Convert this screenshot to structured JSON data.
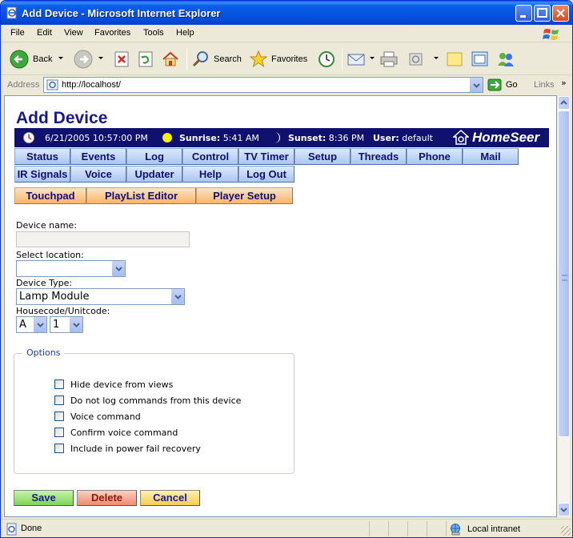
{
  "window": {
    "title": "Add Device - Microsoft Internet Explorer"
  },
  "menubar": {
    "items": [
      "File",
      "Edit",
      "View",
      "Favorites",
      "Tools",
      "Help"
    ]
  },
  "toolbar": {
    "back_label": "Back",
    "search_label": "Search",
    "favorites_label": "Favorites"
  },
  "addressbar": {
    "label": "Address",
    "url": "http://localhost/",
    "go_label": "Go",
    "links_label": "Links"
  },
  "page": {
    "title": "Add Device"
  },
  "infobar": {
    "datetime": "6/21/2005 10:57:00 PM",
    "sunrise_label": "Sunrise:",
    "sunrise_value": "5:41 AM",
    "sunset_label": "Sunset:",
    "sunset_value": "8:36 PM",
    "user_label": "User:",
    "user_value": "default",
    "logo_text": "HomeSeer"
  },
  "nav": {
    "row1": [
      "Status",
      "Events",
      "Log",
      "Control",
      "TV Timer",
      "Setup",
      "Threads",
      "Phone",
      "Mail"
    ],
    "row2": [
      "IR Signals",
      "Voice",
      "Updater",
      "Help",
      "Log Out"
    ],
    "row3": [
      "Touchpad",
      "PlayList Editor",
      "Player Setup"
    ]
  },
  "form": {
    "device_name_label": "Device name:",
    "device_name_value": "",
    "location_label": "Select location:",
    "location_value": "",
    "device_type_label": "Device Type:",
    "device_type_value": "Lamp Module",
    "housecode_label": "Housecode/Unitcode:",
    "housecode_value": "A",
    "unitcode_value": "1"
  },
  "options": {
    "legend": "Options",
    "items": [
      {
        "label": "Hide device from views",
        "checked": false
      },
      {
        "label": "Do not log commands from this device",
        "checked": false
      },
      {
        "label": "Voice command",
        "checked": false
      },
      {
        "label": "Confirm voice command",
        "checked": false
      },
      {
        "label": "Include in power fail recovery",
        "checked": false
      }
    ]
  },
  "actions": {
    "save": "Save",
    "delete": "Delete",
    "cancel": "Cancel"
  },
  "statusbar": {
    "status": "Done",
    "zone": "Local intranet"
  }
}
